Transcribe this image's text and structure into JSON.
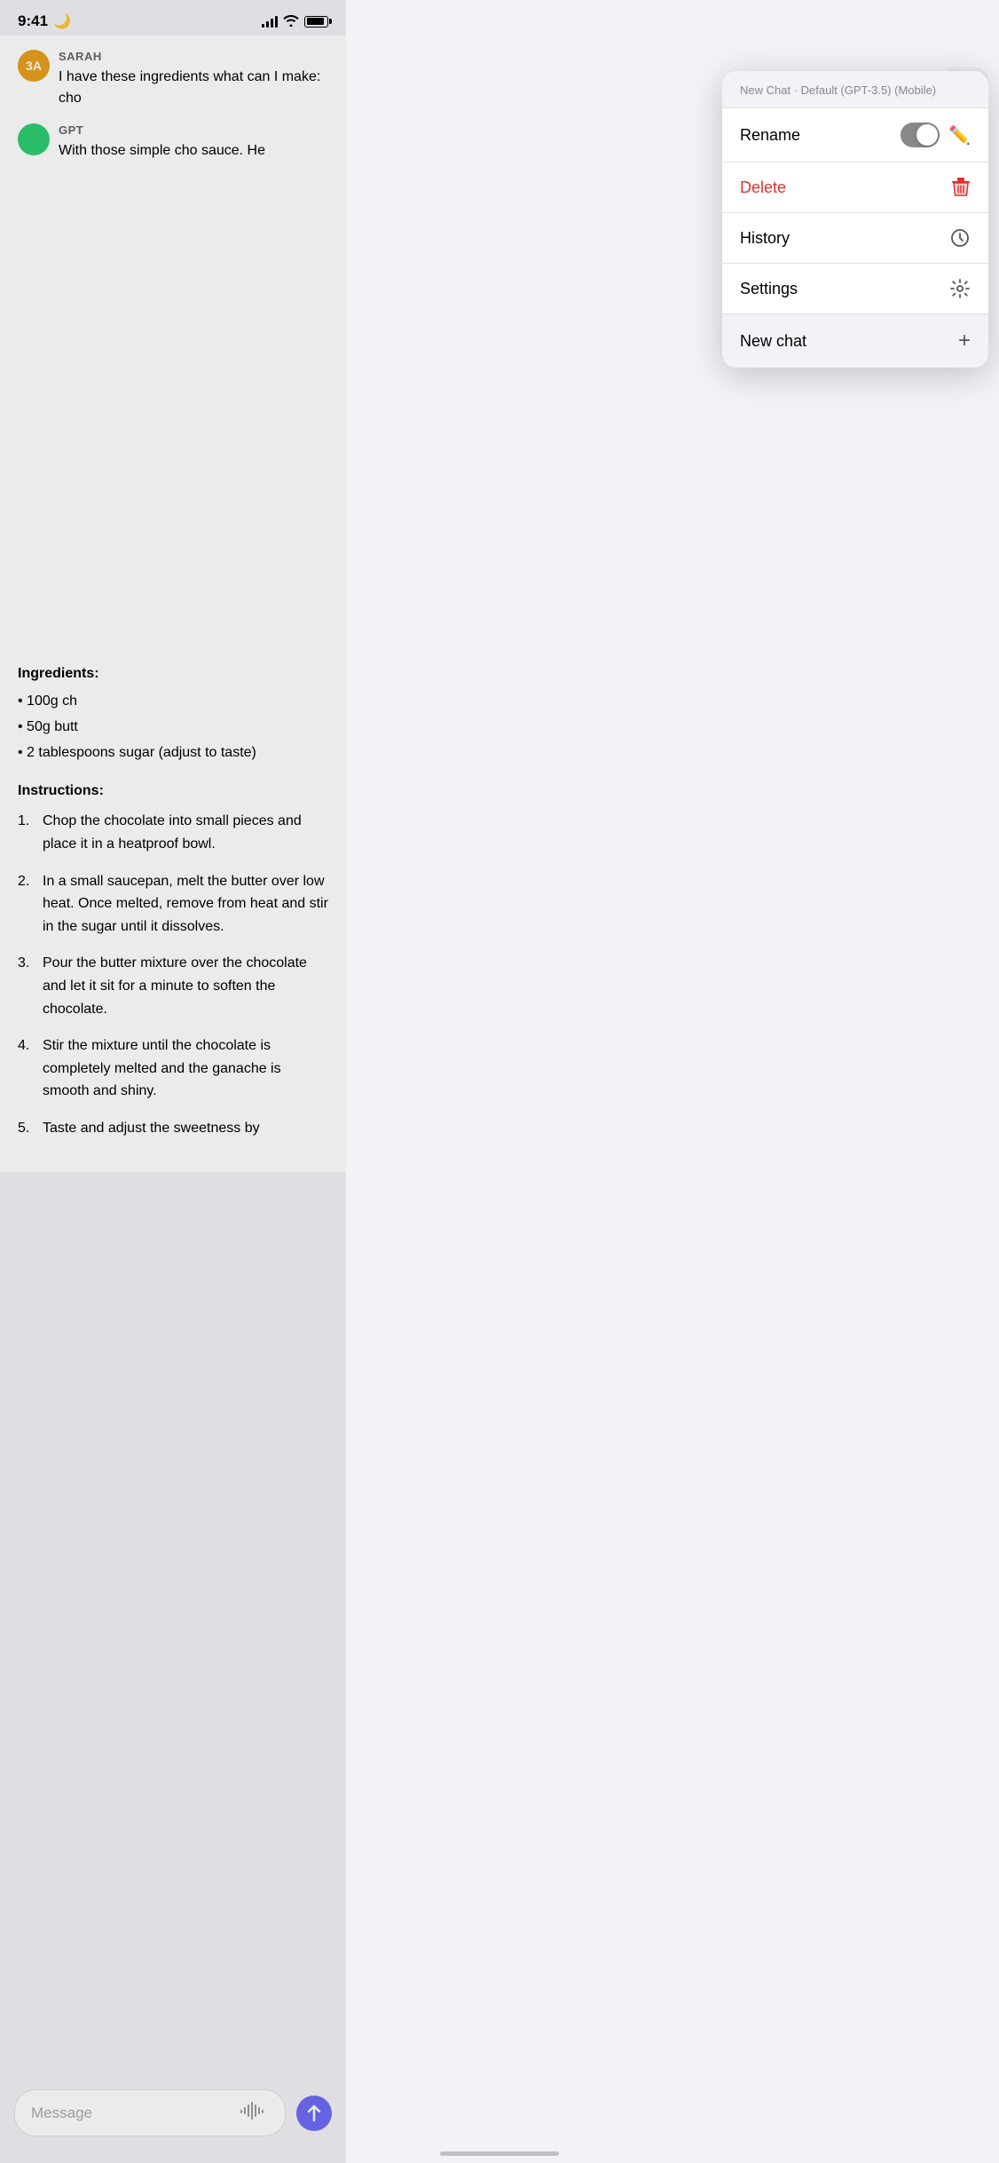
{
  "statusBar": {
    "time": "9:41",
    "moonIcon": "🌙"
  },
  "header": {
    "threeDots": "···"
  },
  "dropdown": {
    "headerText": "New Chat · Default (GPT-3.5) (Mobile)",
    "items": [
      {
        "label": "Rename",
        "iconType": "toggle+pencil"
      },
      {
        "label": "Delete",
        "iconType": "trash",
        "isDelete": true
      },
      {
        "label": "History",
        "iconType": "clock"
      },
      {
        "label": "Settings",
        "iconType": "gear"
      }
    ],
    "newChatLabel": "New chat",
    "newChatIcon": "+"
  },
  "chat": {
    "sarah": {
      "initials": "3A",
      "name": "SARAH",
      "message": "I have these ingredients what can I make: cho"
    },
    "gpt": {
      "name": "GPT",
      "message": "With those simple cho sauce. He"
    },
    "ingredientsTitle": "Ingredients:",
    "ingredients": [
      "• 100g ch",
      "• 50g butt",
      "• 2 tablespoons sugar (adjust to taste)"
    ],
    "instructionsTitle": "Instructions:",
    "instructions": [
      {
        "num": "1.",
        "text": "Chop the chocolate into small pieces and place it in a heatproof bowl."
      },
      {
        "num": "2.",
        "text": "In a small saucepan, melt the butter over low heat. Once melted, remove from heat and stir in the sugar until it dissolves."
      },
      {
        "num": "3.",
        "text": "Pour the butter mixture over the chocolate and let it sit for a minute to soften the chocolate."
      },
      {
        "num": "4.",
        "text": "Stir the mixture until the chocolate is completely melted and the ganache is smooth and shiny."
      },
      {
        "num": "5.",
        "text": "Taste and adjust the sweetness by"
      }
    ]
  },
  "inputBar": {
    "placeholder": "Message"
  }
}
